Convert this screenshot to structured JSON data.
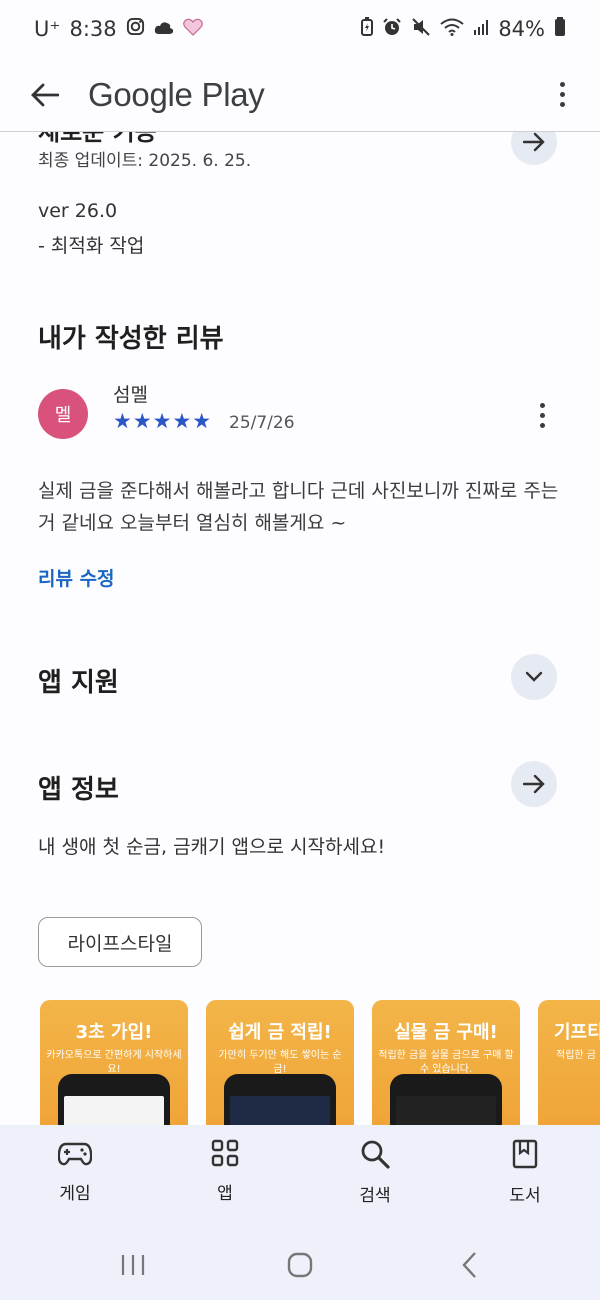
{
  "status_bar": {
    "carrier": "U⁺",
    "time": "8:38",
    "battery": "84%"
  },
  "app_bar": {
    "title": "Google Play"
  },
  "update": {
    "partial_heading": "새로운 기능",
    "last_updated": "최종 업데이트: 2025. 6. 25.",
    "version": "ver 26.0",
    "notes": "- 최적화 작업"
  },
  "my_review": {
    "heading": "내가 작성한 리뷰",
    "avatar_letter": "멜",
    "reviewer": "섬멜",
    "rating": 5,
    "stars": "★★★★★",
    "date": "25/7/26",
    "text": "실제 금을 준다해서 해볼라고 합니다 근데 사진보니까 진짜로 주는거 같네요 오늘부터 열심히 해볼게요 ~",
    "edit_link": "리뷰 수정"
  },
  "app_support": {
    "heading": "앱 지원"
  },
  "app_info": {
    "heading": "앱 정보",
    "description": "내 생애 첫 순금, 금캐기 앱으로 시작하세요!",
    "category_chip": "라이프스타일"
  },
  "screenshots": [
    {
      "title": "3초 가입!",
      "subtitle": "카카오톡으로 간편하게 시작하세요!"
    },
    {
      "title": "쉽게 금 적립!",
      "subtitle": "가만히 두기만 해도 쌓이는 순금!"
    },
    {
      "title": "실물 금 구매!",
      "subtitle": "적립한 금을 실물 금으로 구매 할 수 있습니다."
    },
    {
      "title": "기프티",
      "subtitle": "적립한 금 기프티콘"
    }
  ],
  "bottom_nav": [
    {
      "label": "게임",
      "icon": "gamepad-icon"
    },
    {
      "label": "앱",
      "icon": "apps-grid-icon"
    },
    {
      "label": "검색",
      "icon": "search-icon"
    },
    {
      "label": "도서",
      "icon": "book-icon"
    }
  ],
  "colors": {
    "accent": "#1a66c2",
    "star": "#2b56c5",
    "avatar": "#d9527b",
    "screenshot_bg": "#f0a43a"
  }
}
